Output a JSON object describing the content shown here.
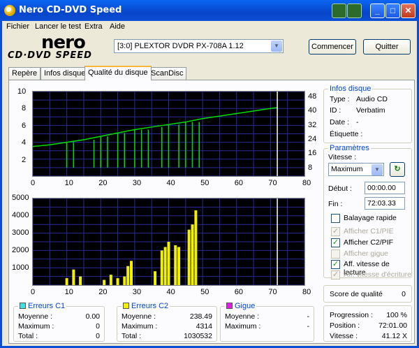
{
  "window": {
    "title": "Nero CD-DVD Speed",
    "minimize": "_",
    "maximize": "□",
    "close": "✕"
  },
  "menu": [
    "Fichier",
    "Lancer le test",
    "Extra",
    "Aide"
  ],
  "logo": {
    "brand": "nero",
    "product": "CD·DVD SPEED"
  },
  "drive": {
    "selected": "[3:0]  PLEXTOR DVDR   PX-708A 1.12"
  },
  "buttons": {
    "start": "Commencer",
    "quit": "Quitter"
  },
  "tabs": [
    "Repère",
    "Infos disque",
    "Qualité du disque",
    "ScanDisc"
  ],
  "active_tab": 2,
  "disc_info": {
    "title": "Infos disque",
    "type_label": "Type :",
    "type_value": "Audio CD",
    "id_label": "ID :",
    "id_value": "Verbatim",
    "date_label": "Date :",
    "date_value": "-",
    "tag_label": "Étiquette :",
    "tag_value": ""
  },
  "settings": {
    "title": "Paramètres",
    "speed_label": "Vitesse :",
    "speed_value": "Maximum",
    "start_label": "Début :",
    "start_value": "00:00.00",
    "end_label": "Fin :",
    "end_value": "72:03.33",
    "quick_scan": "Balayage rapide",
    "show_c1": "Afficher C1/PIE",
    "show_c2": "Afficher C2/PIF",
    "show_jitter": "Afficher gigue",
    "show_read": "Aff. vitesse de lecture",
    "show_write": "Aff. vitesse d'écriture"
  },
  "quality": {
    "label": "Score de qualité",
    "value": "0"
  },
  "progress": {
    "progress_label": "Progression :",
    "progress_value": "100 %",
    "position_label": "Position :",
    "position_value": "72:01.00",
    "speed_label": "Vitesse :",
    "speed_value": "41.12 X"
  },
  "stats": {
    "c1": {
      "title": "Erreurs C1",
      "color": "#40e0e0",
      "avg_label": "Moyenne :",
      "avg": "0.00",
      "max_label": "Maximum :",
      "max": "0",
      "total_label": "Total :",
      "total": "0"
    },
    "c2": {
      "title": "Erreurs C2",
      "color": "#f0f000",
      "avg_label": "Moyenne :",
      "avg": "238.49",
      "max_label": "Maximum :",
      "max": "4314",
      "total_label": "Total :",
      "total": "1030532"
    },
    "jitter": {
      "title": "Gigue",
      "color": "#e020e0",
      "avg_label": "Moyenne :",
      "avg": "-",
      "max_label": "Maximum :",
      "max": "-"
    }
  },
  "chart_data": [
    {
      "type": "line",
      "y_left_ticks": [
        "10",
        "8",
        "6",
        "4",
        "2"
      ],
      "y_right_ticks": [
        "48",
        "40",
        "32",
        "24",
        "16",
        "8"
      ],
      "x_ticks": [
        "0",
        "10",
        "20",
        "30",
        "40",
        "50",
        "60",
        "70",
        "80"
      ],
      "xlim": [
        0,
        80
      ],
      "ylim": [
        0,
        10
      ],
      "grid": true,
      "marker_x": 72,
      "series": [
        {
          "color": "#00e000",
          "x": [
            0,
            5,
            10,
            15,
            20,
            25,
            30,
            35,
            40,
            45,
            50,
            55,
            60,
            65,
            70,
            72
          ],
          "y": [
            3.5,
            3.7,
            4.0,
            4.3,
            4.7,
            5.1,
            5.5,
            5.8,
            6.1,
            6.4,
            6.8,
            7.1,
            7.4,
            7.7,
            8.0,
            8.1
          ]
        }
      ],
      "dips": [
        10,
        12,
        18,
        20,
        22,
        25,
        27,
        30,
        32,
        34,
        38,
        40,
        43,
        45,
        47,
        49
      ]
    },
    {
      "type": "bar",
      "y_ticks": [
        "5000",
        "4000",
        "3000",
        "2000",
        "1000"
      ],
      "x_ticks": [
        "0",
        "10",
        "20",
        "30",
        "40",
        "50",
        "60",
        "70",
        "80"
      ],
      "xlim": [
        0,
        80
      ],
      "ylim": [
        0,
        5000
      ],
      "grid": true,
      "marker_x": 72,
      "series": [
        {
          "name": "Erreurs C2",
          "color": "#f0f000",
          "x": [
            10,
            12,
            14,
            21,
            23,
            25,
            27,
            28,
            29,
            36,
            38,
            39,
            40,
            42,
            43,
            46,
            47,
            48
          ],
          "y": [
            400,
            900,
            500,
            300,
            600,
            400,
            500,
            1100,
            1400,
            800,
            2000,
            2200,
            2500,
            2300,
            2200,
            3200,
            3500,
            4314
          ]
        }
      ]
    }
  ]
}
